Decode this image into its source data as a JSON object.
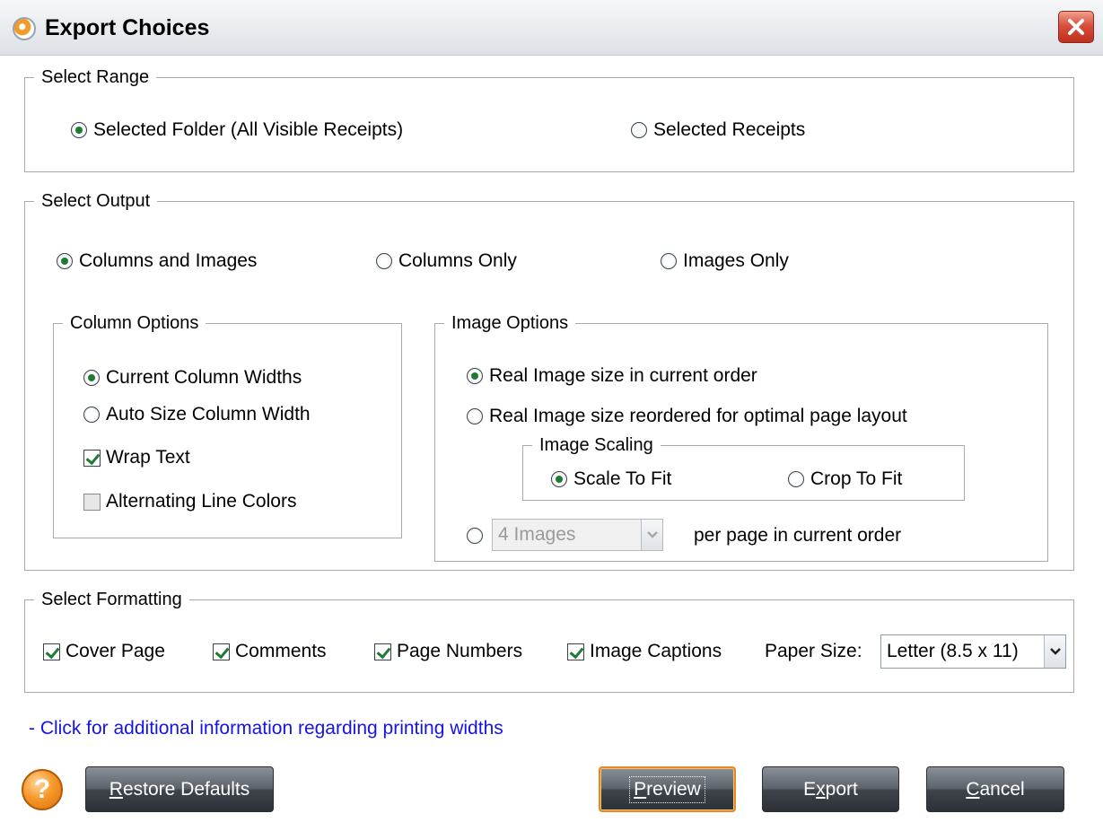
{
  "window": {
    "title": "Export Choices"
  },
  "select_range": {
    "legend": "Select Range",
    "options": [
      "Selected Folder (All Visible Receipts)",
      "Selected Receipts"
    ],
    "selected": 0
  },
  "select_output": {
    "legend": "Select Output",
    "options": [
      "Columns and Images",
      "Columns Only",
      "Images Only"
    ],
    "selected": 0
  },
  "column_options": {
    "legend": "Column Options",
    "width_options": [
      "Current Column Widths",
      "Auto Size Column Width"
    ],
    "width_selected": 0,
    "wrap_text": {
      "label": "Wrap Text",
      "checked": true
    },
    "alternating": {
      "label": "Alternating Line Colors",
      "checked": false
    }
  },
  "image_options": {
    "legend": "Image Options",
    "options": [
      "Real Image size in current order",
      "Real Image size reordered for optimal page layout"
    ],
    "selected": 0,
    "scaling": {
      "legend": "Image Scaling",
      "options": [
        "Scale To Fit",
        "Crop To Fit"
      ],
      "selected": 0
    },
    "per_page": {
      "combo_value": "4 Images",
      "label": "per page in current order",
      "enabled": false
    }
  },
  "select_formatting": {
    "legend": "Select Formatting",
    "checks": [
      {
        "label": "Cover Page",
        "checked": true
      },
      {
        "label": "Comments",
        "checked": true
      },
      {
        "label": "Page Numbers",
        "checked": true
      },
      {
        "label": "Image Captions",
        "checked": true
      }
    ],
    "paper_size_label": "Paper Size:",
    "paper_size_value": "Letter (8.5 x 11)"
  },
  "info_link": "- Click for additional information regarding printing widths",
  "buttons": {
    "restore": {
      "mnemonic": "R",
      "rest": "estore Defaults"
    },
    "preview": {
      "mnemonic": "P",
      "rest": "review"
    },
    "export": {
      "first": "E",
      "mnemonic": "x",
      "rest": "port"
    },
    "cancel": {
      "mnemonic": "C",
      "rest": "ancel"
    }
  },
  "help_icon": "?",
  "colors": {
    "accent_green": "#1f7a33",
    "link_blue": "#1414e6",
    "default_button_border": "#e48a1f"
  }
}
